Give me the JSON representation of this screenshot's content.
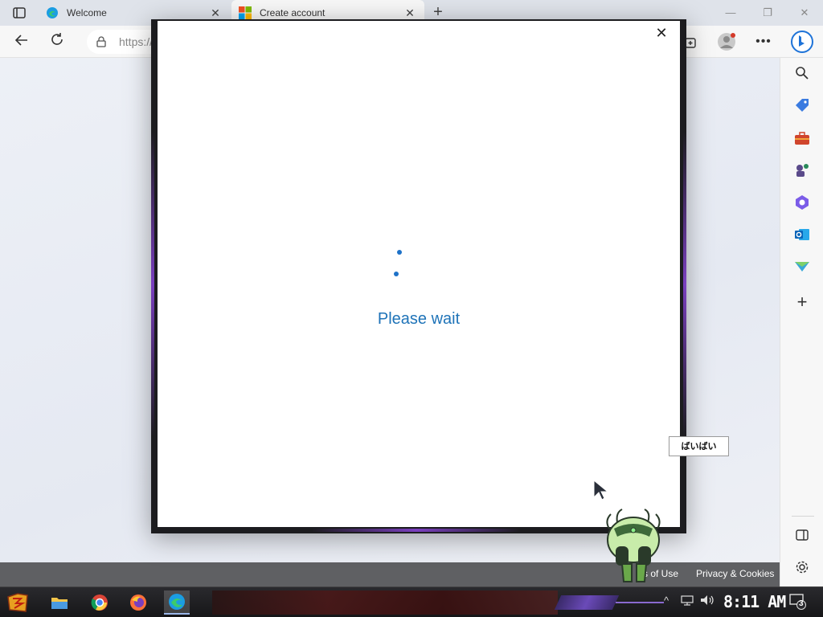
{
  "browser": {
    "tabs": [
      {
        "title": "Welcome",
        "icon": "edge-icon",
        "active": false
      },
      {
        "title": "Create account",
        "icon": "microsoft-logo-icon",
        "active": true
      }
    ],
    "url": "https://",
    "window_controls": {
      "minimize": "—",
      "restore": "❐",
      "close": "✕"
    }
  },
  "dialog": {
    "status_text": "Please wait",
    "close_label": "✕"
  },
  "footer": {
    "links": [
      {
        "label": "s of Use"
      },
      {
        "label": "Privacy & Cookies"
      }
    ]
  },
  "tooltip": {
    "text": "ばいばい"
  },
  "sidebar": {
    "items": [
      "search-icon",
      "shopping-tag-icon",
      "tools-briefcase-icon",
      "games-icon",
      "microsoft-365-icon",
      "outlook-icon",
      "drop-send-icon",
      "add-icon"
    ],
    "bottom": [
      "sidebar-toggle-icon",
      "settings-icon"
    ]
  },
  "taskbar": {
    "apps": [
      "start-icon",
      "file-explorer-icon",
      "chrome-icon",
      "firefox-icon",
      "edge-icon"
    ],
    "clock": "8:11 AM",
    "notification_count": "3"
  },
  "colors": {
    "accent": "#1e73b8",
    "dialog_border": "#1c1c1f",
    "glow": "#7a3fbf"
  }
}
